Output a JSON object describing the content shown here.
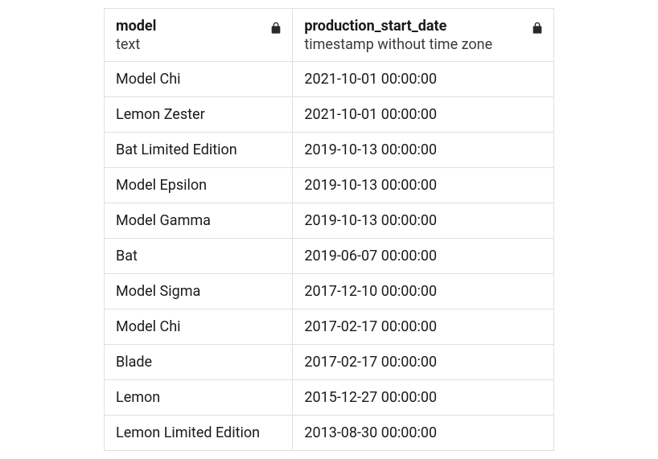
{
  "table": {
    "columns": [
      {
        "name": "model",
        "type": "text",
        "locked": true
      },
      {
        "name": "production_start_date",
        "type": "timestamp without time zone",
        "locked": true
      }
    ],
    "rows": [
      {
        "model": "Model Chi",
        "production_start_date": "2021-10-01 00:00:00"
      },
      {
        "model": "Lemon Zester",
        "production_start_date": "2021-10-01 00:00:00"
      },
      {
        "model": "Bat Limited Edition",
        "production_start_date": "2019-10-13 00:00:00"
      },
      {
        "model": "Model Epsilon",
        "production_start_date": "2019-10-13 00:00:00"
      },
      {
        "model": "Model Gamma",
        "production_start_date": "2019-10-13 00:00:00"
      },
      {
        "model": "Bat",
        "production_start_date": "2019-06-07 00:00:00"
      },
      {
        "model": "Model Sigma",
        "production_start_date": "2017-12-10 00:00:00"
      },
      {
        "model": "Model Chi",
        "production_start_date": "2017-02-17 00:00:00"
      },
      {
        "model": "Blade",
        "production_start_date": "2017-02-17 00:00:00"
      },
      {
        "model": "Lemon",
        "production_start_date": "2015-12-27 00:00:00"
      },
      {
        "model": "Lemon Limited Edition",
        "production_start_date": "2013-08-30 00:00:00"
      }
    ]
  }
}
